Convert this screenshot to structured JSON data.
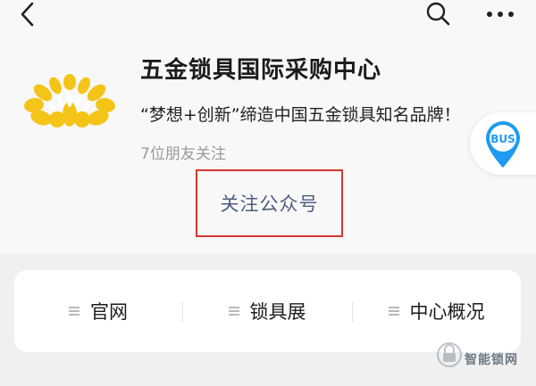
{
  "nav": {
    "back_icon": "chevron-left-icon",
    "search_icon": "search-icon",
    "more_icon": "more-horizontal-icon"
  },
  "account": {
    "name": "五金锁具国际采购中心",
    "slogan": "“梦想+创新”缔造中国五金锁具知名品牌！",
    "followers_text": "7位朋友关注",
    "logo_icon": "chrysanthemum-logo",
    "logo_color": "#f4c418"
  },
  "bus_badge": {
    "label": "BUS",
    "color": "#1e9bf0"
  },
  "follow_button": {
    "label": "关注公众号",
    "highlight_color": "#d4362f"
  },
  "menu": {
    "items": [
      {
        "label": "官网",
        "icon": "menu-lines-icon"
      },
      {
        "label": "锁具展",
        "icon": "menu-lines-icon"
      },
      {
        "label": "中心概况",
        "icon": "menu-lines-icon"
      }
    ]
  },
  "watermark": {
    "text": "智能锁网",
    "icon": "lock-logo-icon"
  }
}
